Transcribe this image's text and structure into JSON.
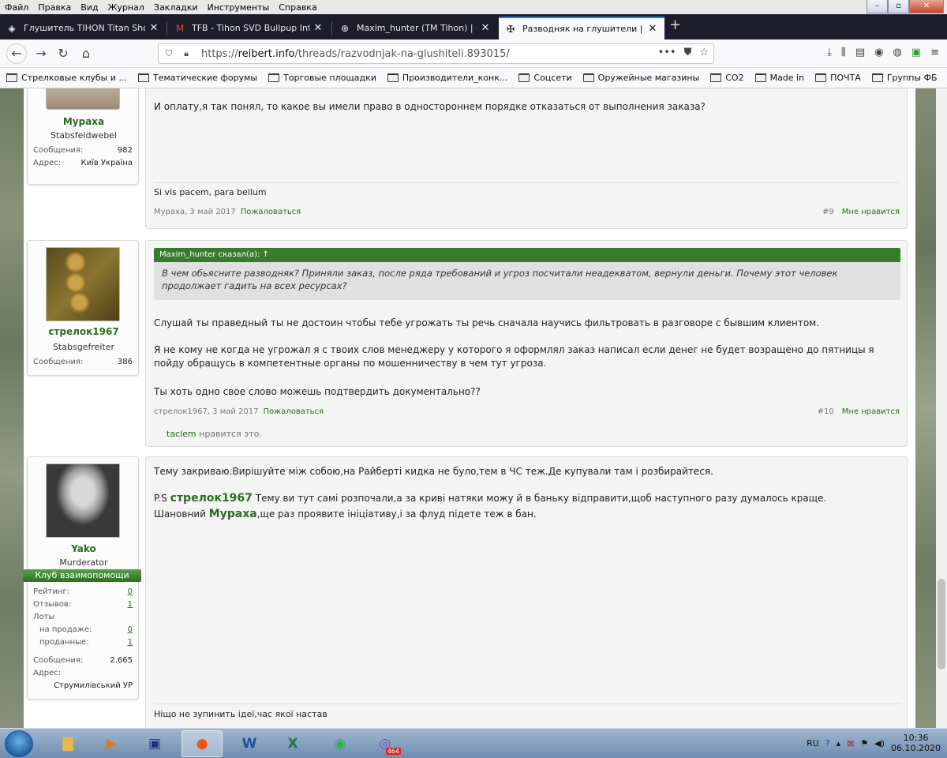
{
  "menu": [
    "Файл",
    "Правка",
    "Вид",
    "Журнал",
    "Закладки",
    "Инструменты",
    "Справка"
  ],
  "window_controls": {
    "minimize": "–",
    "restore": "▫",
    "close": "✕"
  },
  "tabs": [
    {
      "label": "Глушитель TIHON Titan Shot",
      "icon": "tihon-icon",
      "active": false
    },
    {
      "label": "TFB - Tihon SVD Bullpup Inform",
      "icon": "gmail-icon",
      "active": false
    },
    {
      "label": "Maxim_hunter (TM Tihon) | Стр",
      "icon": "globe-icon",
      "active": false
    },
    {
      "label": "Разводняк на глушители | REIB",
      "icon": "cross-icon",
      "active": true
    }
  ],
  "newtab": "+",
  "url": {
    "prefix": "https://",
    "host": "reibert.info",
    "path": "/threads/razvodnjak-na-glushiteli.893015/"
  },
  "url_actions": {
    "more": "•••"
  },
  "bookmarks": [
    "Стрелковые клубы и ...",
    "Тематические форумы",
    "Торговые площадки",
    "Производители_конк...",
    "Соцсети",
    "Оружейные магазины",
    "CO2",
    "Made in",
    "ПОЧТА",
    "Группы ФБ"
  ],
  "posts": [
    {
      "user": {
        "name": "Мураха",
        "title": "Stabsfeldwebel",
        "stats": [
          {
            "k": "Сообщения:",
            "v": "982"
          },
          {
            "k": "Адрес:",
            "v": "Київ Україна"
          }
        ]
      },
      "text": [
        "И оплату,я так понял, то какое вы имели право в одностороннем порядке отказаться от выполнения заказа?"
      ],
      "signature": "Si vis pacem, para bellum",
      "author_date": "Мураха, 3 май 2017",
      "report": "Пожаловаться",
      "num": "#9",
      "like": "Мне нравится"
    },
    {
      "user": {
        "name": "стрелок1967",
        "title": "Stabsgefreiter",
        "stats": [
          {
            "k": "Сообщения:",
            "v": "386"
          }
        ]
      },
      "quote_head": "Maxim_hunter сказал(а): ↑",
      "quote": "В чем обьясните разводняк? Приняли заказ, после ряда требований и угроз посчитали неадекватом, вернули деньги. Почему этот человек продолжает гадить на всех ресурсах?",
      "text": [
        "Слушай ты праведный ты не достоин чтобы тебе угрожать ты речь сначала научись фильтровать в разговоре с бывшим клиентом.",
        "Я не кому не когда не угрожал я с твоих слов менеджеру у которого я оформлял заказ написал если денег не будет возращено до пятницы я",
        "пойду обращусь в компетентные органы по мошенничеству в чем тут угроза.",
        "Ты хоть одно свое слово можешь подтвердить документально??"
      ],
      "author_date": "стрелок1967, 3 май 2017",
      "report": "Пожаловаться",
      "num": "#10",
      "like": "Мне нравится",
      "likes_user": "taclem",
      "likes_text": "нравится это."
    },
    {
      "user": {
        "name": "Yako",
        "title": "Murderator",
        "club": "Клуб взаимопомощи",
        "stats": [
          {
            "k": "Рейтинг:",
            "v": "0"
          },
          {
            "k": "Отзывов:",
            "v": "1"
          },
          {
            "k": "Лоты",
            "v": ""
          },
          {
            "k": "на продаже:",
            "v": "0"
          },
          {
            "k": "проданные:",
            "v": "1"
          },
          {
            "k": "Сообщения:",
            "v": "2.665"
          },
          {
            "k": "Адрес:",
            "v": ""
          },
          {
            "k": "",
            "v": "Струмилівський УР"
          }
        ]
      },
      "text": [
        "Тему закриваю.Вирішуйте між собою,на Райберті кидка не було,тем в ЧС теж.Де купували там і розбирайтеся."
      ],
      "ps_prefix": "P.S",
      "ps_mention1": "стрелок1967",
      "ps_rest1": "Тему ви тут самі розпочали,а за криві натяки можу й в баньку відправити,щоб наступного разу думалось краще.",
      "ps_prefix2": "Шановний",
      "ps_mention2": "Мураха",
      "ps_rest2": ",ще раз проявите ініціативу,і за флуд підете теж в бан.",
      "signature": "Ніщо не зупинить ідеї,час якої настав"
    }
  ],
  "taskbar": {
    "lang": "RU",
    "time": "10:36",
    "date": "06.10.2020",
    "viber_badge": "464"
  }
}
